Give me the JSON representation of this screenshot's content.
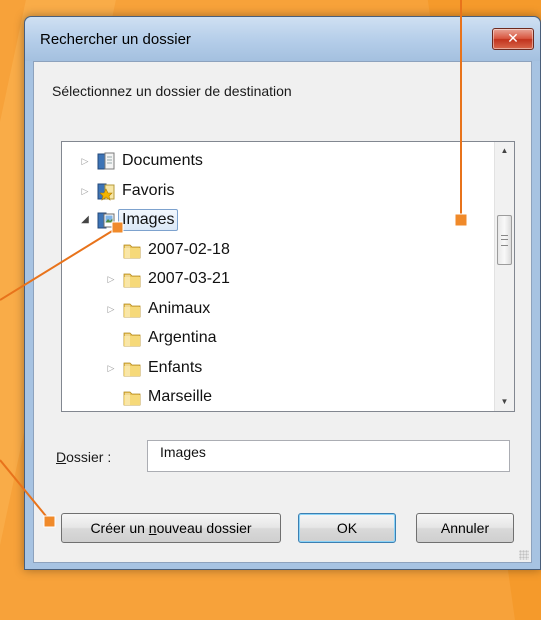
{
  "dialog": {
    "title": "Rechercher un dossier",
    "close_glyph": "✕",
    "instruction": "Sélectionnez un dossier de destination"
  },
  "tree": {
    "items": [
      {
        "label": "Documents",
        "icon": "documents-library-icon",
        "expander": "collapsed",
        "selected": false
      },
      {
        "label": "Favoris",
        "icon": "favorites-star-icon",
        "expander": "collapsed",
        "selected": false
      },
      {
        "label": "Images",
        "icon": "pictures-library-icon",
        "expander": "expanded",
        "selected": true
      },
      {
        "label": "2007-02-18",
        "icon": "folder-icon",
        "expander": "none",
        "selected": false
      },
      {
        "label": "2007-03-21",
        "icon": "folder-icon",
        "expander": "collapsed",
        "selected": false
      },
      {
        "label": "Animaux",
        "icon": "folder-icon",
        "expander": "collapsed",
        "selected": false
      },
      {
        "label": "Argentina",
        "icon": "folder-icon",
        "expander": "none",
        "selected": false
      },
      {
        "label": "Enfants",
        "icon": "folder-icon",
        "expander": "collapsed",
        "selected": false
      },
      {
        "label": "Marseille",
        "icon": "folder-icon",
        "expander": "none",
        "selected": false
      }
    ],
    "scroll_up_glyph": "▲",
    "scroll_down_glyph": "▼"
  },
  "folder_field": {
    "label_first": "D",
    "label_rest": "ossier :",
    "value": "Images"
  },
  "buttons": {
    "new_folder_before": "Créer un ",
    "new_folder_key": "n",
    "new_folder_after": "ouveau dossier",
    "ok": "OK",
    "cancel": "Annuler"
  },
  "colors": {
    "background": "#f7a23a",
    "callout_line": "#e8731b",
    "selection_border": "#7da2ce",
    "frame": "#a7c3e2"
  }
}
